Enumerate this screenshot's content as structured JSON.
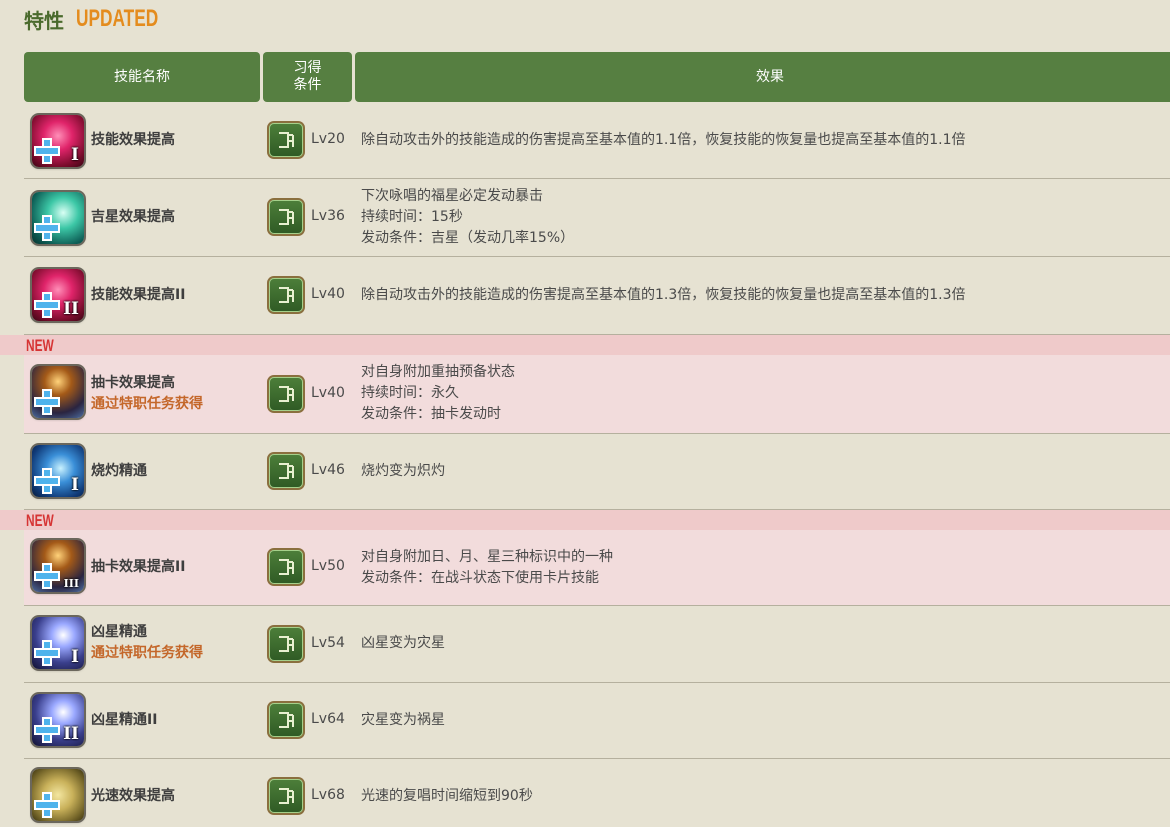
{
  "header": {
    "title": "特性",
    "badge": "UPDATED"
  },
  "columns": {
    "name": "技能名称",
    "condition_line1": "习得",
    "condition_line2": "条件",
    "effect": "效果"
  },
  "new_tag": "NEW",
  "rows": [
    {
      "name": "技能效果提高",
      "sub": "",
      "level": "Lv20",
      "icon": "skill-boost-red-icon",
      "numeral": "I",
      "effect": [
        "除自动攻击外的技能造成的伤害提高至基本值的1.1倍，恢复技能的恢复量也提高至基本值的1.1倍"
      ]
    },
    {
      "name": "吉星效果提高",
      "sub": "",
      "level": "Lv36",
      "icon": "lucky-star-teal-icon",
      "numeral": "",
      "effect": [
        "下次咏唱的福星必定发动暴击",
        "持续时间：15秒",
        "发动条件：吉星（发动几率15%）"
      ]
    },
    {
      "name": "技能效果提高II",
      "sub": "",
      "level": "Lv40",
      "icon": "skill-boost-red-icon",
      "numeral": "II",
      "effect": [
        "除自动攻击外的技能造成的伤害提高至基本值的1.3倍，恢复技能的恢复量也提高至基本值的1.3倍"
      ]
    },
    {
      "name": "抽卡效果提高",
      "sub": "通过特职任务获得",
      "level": "Lv40",
      "icon": "card-draw-icon",
      "numeral": "",
      "effect": [
        "对自身附加重抽预备状态",
        "持续时间：永久",
        "发动条件：抽卡发动时"
      ]
    },
    {
      "name": "烧灼精通",
      "sub": "",
      "level": "Lv46",
      "icon": "malefic-blue-icon",
      "numeral": "I",
      "effect": [
        "烧灼变为炽灼"
      ]
    },
    {
      "name": "抽卡效果提高II",
      "sub": "",
      "level": "Lv50",
      "icon": "card-draw-icon",
      "numeral": "",
      "effect": [
        "对自身附加日、月、星三种标识中的一种",
        "发动条件：在战斗状态下使用卡片技能"
      ]
    },
    {
      "name": "凶星精通",
      "sub": "通过特职任务获得",
      "level": "Lv54",
      "icon": "malefic-star-icon",
      "numeral": "I",
      "effect": [
        "凶星变为灾星"
      ]
    },
    {
      "name": "凶星精通II",
      "sub": "",
      "level": "Lv64",
      "icon": "malefic-star-icon",
      "numeral": "II",
      "effect": [
        "灾星变为祸星"
      ]
    },
    {
      "name": "光速效果提高",
      "sub": "",
      "level": "Lv68",
      "icon": "lightspeed-gold-icon",
      "numeral": "",
      "effect": [
        "光速的复唱时间缩短到90秒"
      ]
    }
  ]
}
